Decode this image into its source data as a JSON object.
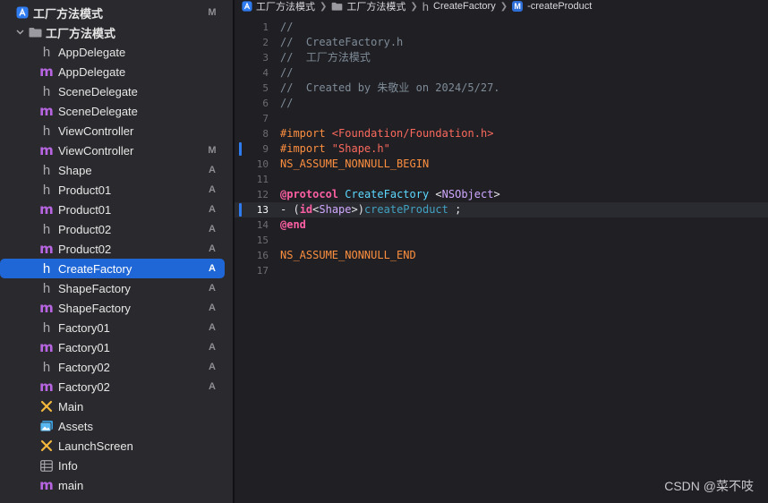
{
  "sidebar": {
    "project": {
      "label": "工厂方法模式",
      "status": "M",
      "icon": "xcode-project-icon"
    },
    "group": {
      "label": "工厂方法模式",
      "icon": "folder-icon"
    },
    "files": [
      {
        "name": "AppDelegate",
        "kind": "h",
        "status": ""
      },
      {
        "name": "AppDelegate",
        "kind": "m",
        "status": ""
      },
      {
        "name": "SceneDelegate",
        "kind": "h",
        "status": ""
      },
      {
        "name": "SceneDelegate",
        "kind": "m",
        "status": ""
      },
      {
        "name": "ViewController",
        "kind": "h",
        "status": ""
      },
      {
        "name": "ViewController",
        "kind": "m",
        "status": "M"
      },
      {
        "name": "Shape",
        "kind": "h",
        "status": "A"
      },
      {
        "name": "Product01",
        "kind": "h",
        "status": "A"
      },
      {
        "name": "Product01",
        "kind": "m",
        "status": "A"
      },
      {
        "name": "Product02",
        "kind": "h",
        "status": "A"
      },
      {
        "name": "Product02",
        "kind": "m",
        "status": "A"
      },
      {
        "name": "CreateFactory",
        "kind": "h",
        "status": "A",
        "selected": true
      },
      {
        "name": "ShapeFactory",
        "kind": "h",
        "status": "A"
      },
      {
        "name": "ShapeFactory",
        "kind": "m",
        "status": "A"
      },
      {
        "name": "Factory01",
        "kind": "h",
        "status": "A"
      },
      {
        "name": "Factory01",
        "kind": "m",
        "status": "A"
      },
      {
        "name": "Factory02",
        "kind": "h",
        "status": "A"
      },
      {
        "name": "Factory02",
        "kind": "m",
        "status": "A"
      },
      {
        "name": "Main",
        "kind": "storyboard",
        "status": ""
      },
      {
        "name": "Assets",
        "kind": "assets",
        "status": ""
      },
      {
        "name": "LaunchScreen",
        "kind": "storyboard",
        "status": ""
      },
      {
        "name": "Info",
        "kind": "plist",
        "status": ""
      },
      {
        "name": "main",
        "kind": "m",
        "status": ""
      }
    ]
  },
  "jumpbar": {
    "project": "工厂方法模式",
    "folder": "工厂方法模式",
    "file": "CreateFactory",
    "method_badge": "M",
    "method": "-createProduct"
  },
  "editor": {
    "current_line": 13,
    "changed_lines": [
      9,
      13
    ],
    "lines": [
      {
        "n": "1",
        "parts": [
          {
            "c": "comment",
            "t": "//"
          }
        ]
      },
      {
        "n": "2",
        "parts": [
          {
            "c": "comment",
            "t": "//  CreateFactory.h"
          }
        ]
      },
      {
        "n": "3",
        "parts": [
          {
            "c": "comment",
            "t": "//  工厂方法模式"
          }
        ]
      },
      {
        "n": "4",
        "parts": [
          {
            "c": "comment",
            "t": "//"
          }
        ]
      },
      {
        "n": "5",
        "parts": [
          {
            "c": "comment",
            "t": "//  Created by 朱敬业 on 2024/5/27."
          }
        ]
      },
      {
        "n": "6",
        "parts": [
          {
            "c": "comment",
            "t": "//"
          }
        ]
      },
      {
        "n": "7",
        "parts": []
      },
      {
        "n": "8",
        "parts": [
          {
            "c": "pre",
            "t": "#import "
          },
          {
            "c": "str",
            "t": "<Foundation/Foundation.h>"
          }
        ]
      },
      {
        "n": "9",
        "parts": [
          {
            "c": "pre",
            "t": "#import "
          },
          {
            "c": "str",
            "t": "\"Shape.h\""
          }
        ]
      },
      {
        "n": "10",
        "parts": [
          {
            "c": "pre",
            "t": "NS_ASSUME_NONNULL_BEGIN"
          }
        ]
      },
      {
        "n": "11",
        "parts": []
      },
      {
        "n": "12",
        "parts": [
          {
            "c": "kw",
            "t": "@protocol"
          },
          {
            "c": "plain",
            "t": " "
          },
          {
            "c": "proto",
            "t": "CreateFactory"
          },
          {
            "c": "plain",
            "t": " <"
          },
          {
            "c": "type",
            "t": "NSObject"
          },
          {
            "c": "plain",
            "t": ">"
          }
        ]
      },
      {
        "n": "13",
        "parts": [
          {
            "c": "plain",
            "t": "- ("
          },
          {
            "c": "kw",
            "t": "id"
          },
          {
            "c": "plain",
            "t": "<"
          },
          {
            "c": "type",
            "t": "Shape"
          },
          {
            "c": "plain",
            "t": ">)"
          },
          {
            "c": "method",
            "t": "createProduct"
          },
          {
            "c": "plain",
            "t": " ;"
          }
        ]
      },
      {
        "n": "14",
        "parts": [
          {
            "c": "kw",
            "t": "@end"
          }
        ]
      },
      {
        "n": "15",
        "parts": []
      },
      {
        "n": "16",
        "parts": [
          {
            "c": "pre",
            "t": "NS_ASSUME_NONNULL_END"
          }
        ]
      },
      {
        "n": "17",
        "parts": []
      }
    ]
  },
  "watermark": "CSDN @菜不吱",
  "colors": {
    "selection": "#1f66d6",
    "m_icon": "#b765e0",
    "sidebar_bg": "#2a2a2e",
    "editor_bg": "#1f1f24"
  }
}
